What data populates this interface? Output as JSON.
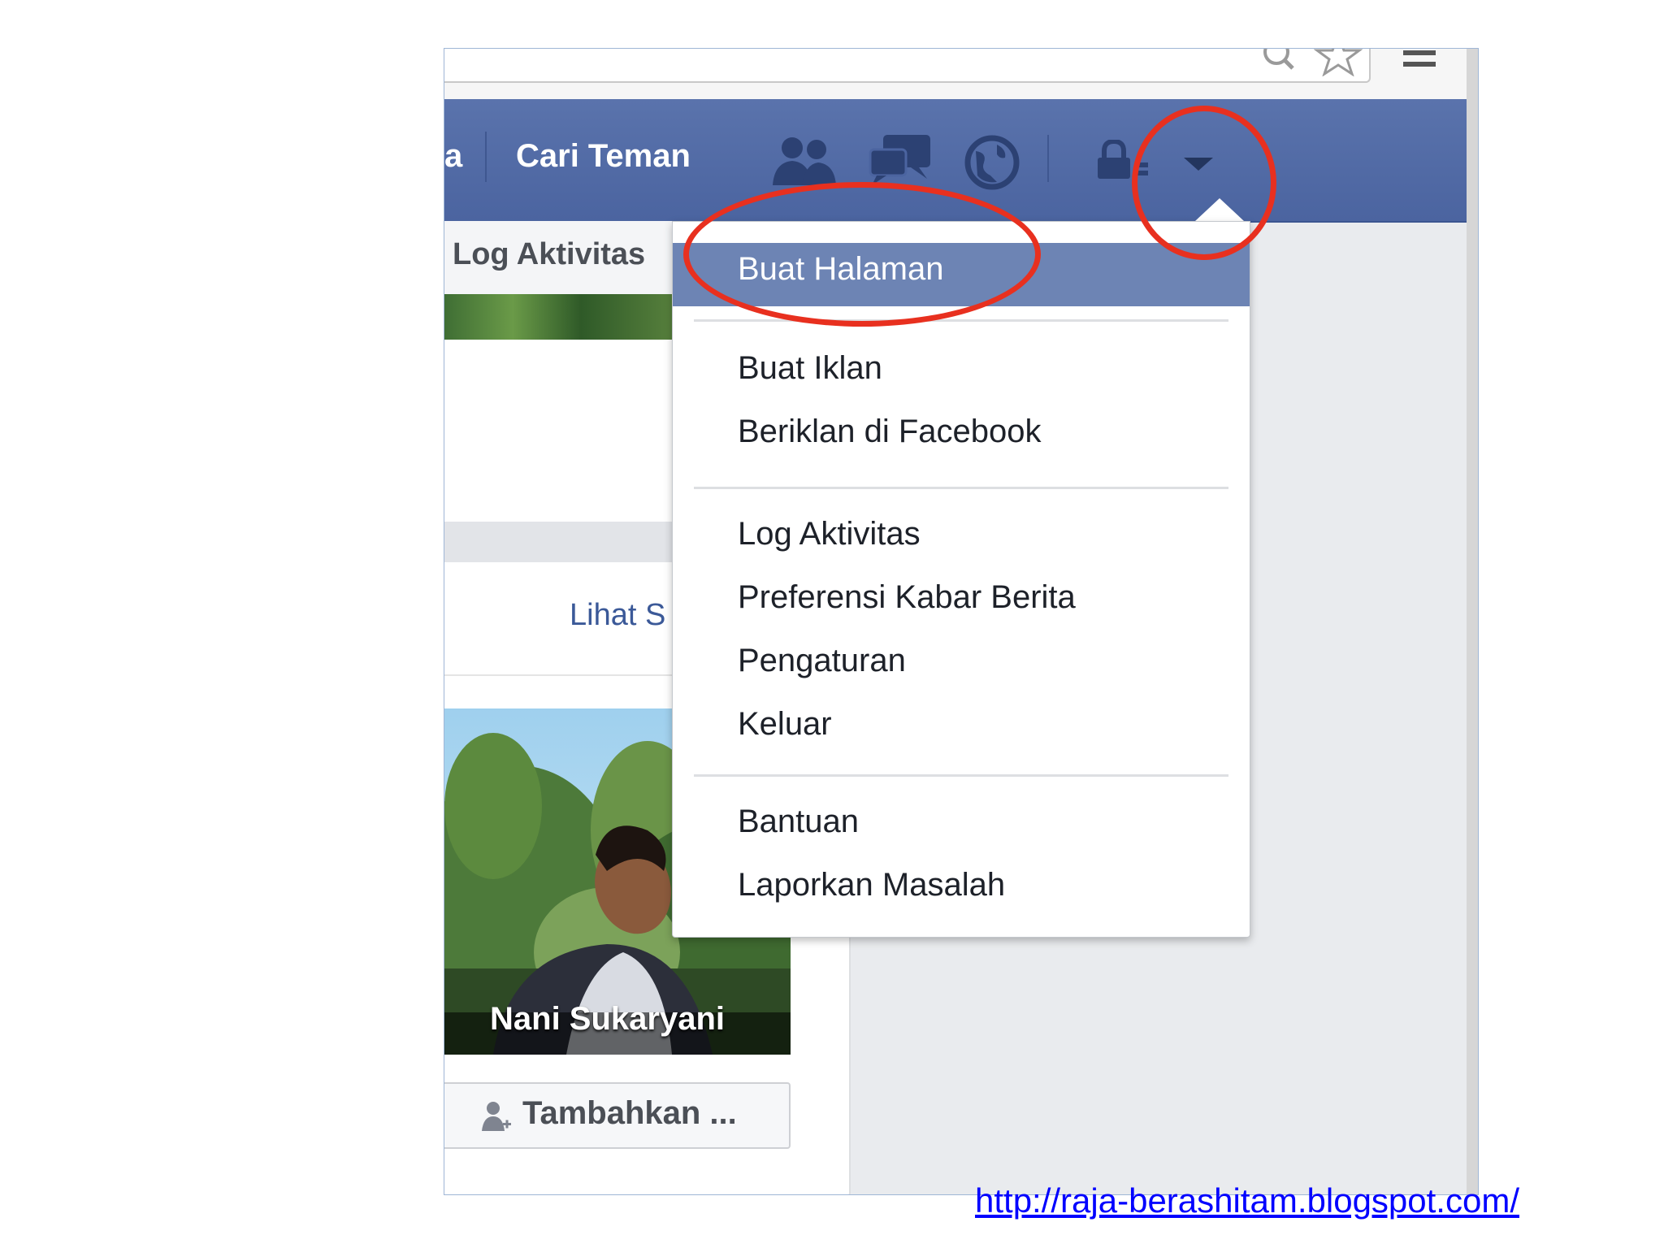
{
  "nav": {
    "prev_item_tail": "a",
    "find_friends": "Cari Teman"
  },
  "left": {
    "profile_tab": "Log Aktivitas",
    "see_all_link": "Lihat S",
    "person_name": "Nani Sukaryani",
    "add_friend_button": "Tambahkan ..."
  },
  "dropdown": {
    "highlighted": "Buat Halaman",
    "group1": [
      "Buat Iklan",
      "Beriklan di Facebook"
    ],
    "group2": [
      "Log Aktivitas",
      "Preferensi Kabar Berita",
      "Pengaturan",
      "Keluar"
    ],
    "group3": [
      "Bantuan",
      "Laporkan Masalah"
    ]
  },
  "footer": {
    "blog_url": "http://raja-berashitam.blogspot.com/"
  },
  "colors": {
    "fb_blue": "#4b64a0",
    "highlight": "#6d84b4",
    "annotation_red": "#e8301f",
    "link_blue": "#0000ff"
  },
  "icons": [
    "search-icon",
    "star-icon",
    "browser-menu-icon",
    "friend-requests-icon",
    "messages-icon",
    "notifications-globe-icon",
    "privacy-lock-icon",
    "account-caret-icon",
    "add-friend-icon"
  ]
}
